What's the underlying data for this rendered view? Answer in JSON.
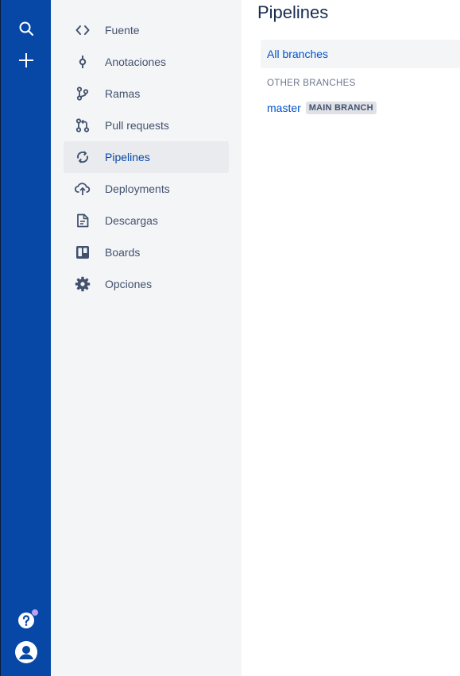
{
  "global_nav": {
    "background": "#0747a6"
  },
  "sidebar": {
    "items": [
      {
        "label": "Fuente",
        "icon": "code-icon"
      },
      {
        "label": "Anotaciones",
        "icon": "commit-icon"
      },
      {
        "label": "Ramas",
        "icon": "branch-icon"
      },
      {
        "label": "Pull requests",
        "icon": "pull-request-icon"
      },
      {
        "label": "Pipelines",
        "icon": "pipelines-icon",
        "active": true
      },
      {
        "label": "Deployments",
        "icon": "cloud-upload-icon"
      },
      {
        "label": "Descargas",
        "icon": "document-icon"
      },
      {
        "label": "Boards",
        "icon": "board-icon"
      },
      {
        "label": "Opciones",
        "icon": "gear-icon"
      }
    ]
  },
  "main": {
    "title": "Pipelines",
    "all_branches": "All branches",
    "other_branches_heading": "OTHER BRANCHES",
    "branches": [
      {
        "name": "master",
        "badge": "MAIN BRANCH"
      }
    ]
  },
  "colors": {
    "accent": "#0052cc",
    "active_text": "#0747a6",
    "text": "#42526e",
    "title": "#172b4d",
    "sidebar_bg": "#f4f5f7"
  }
}
